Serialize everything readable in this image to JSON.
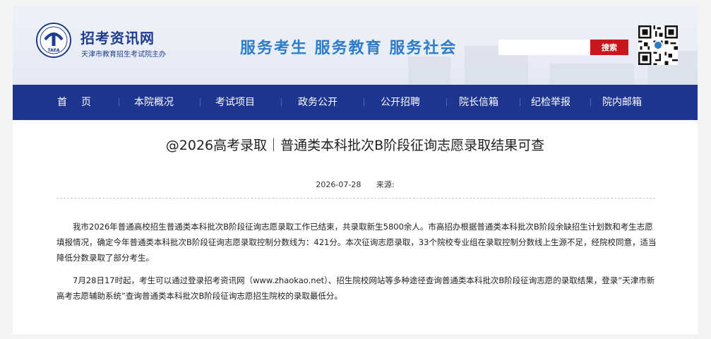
{
  "header": {
    "site_title": "招考资讯网",
    "site_subtitle": "天津市教育招生考试院主办",
    "emblem_text": "TAEA",
    "slogan": "服务考生  服务教育  服务社会",
    "search": {
      "placeholder": "",
      "button_label": "搜索"
    },
    "qr_icon": "qr-code-icon"
  },
  "nav": {
    "items": [
      {
        "label": "首页"
      },
      {
        "label": "本院概况"
      },
      {
        "label": "考试项目"
      },
      {
        "label": "政务公开"
      },
      {
        "label": "公开招聘"
      },
      {
        "label": "院长信箱"
      },
      {
        "label": "纪检举报"
      },
      {
        "label": "院内邮箱"
      }
    ]
  },
  "article": {
    "title": "@2026高考录取｜普通类本科批次B阶段征询志愿录取结果可查",
    "date": "2026-07-28",
    "source_label": "来源:",
    "paragraphs": [
      "我市2026年普通高校招生普通类本科批次B阶段征询志愿录取工作已结束，共录取新生5800余人。市高招办根据普通类本科批次B阶段余缺招生计划数和考生志愿填报情况，确定今年普通类本科批次B阶段征询志愿录取控制分数线为：421分。本次征询志愿录取，33个院校专业组在录取控制分数线上生源不足，经院校同意，适当降低分数录取了部分考生。",
      "7月28日17时起，考生可以通过登录招考资讯网（www.zhaokao.net）、招生院校网站等多种途径查询普通类本科批次B阶段征询志愿的录取结果，登录“天津市新高考志愿辅助系统”查询普通类本科批次B阶段征询志愿招生院校的录取最低分。"
    ]
  },
  "colors": {
    "nav_bg": "#1e3690",
    "brand_blue": "#1e3d8f",
    "slogan_blue": "#2f7dc8",
    "search_red": "#c8161d"
  }
}
